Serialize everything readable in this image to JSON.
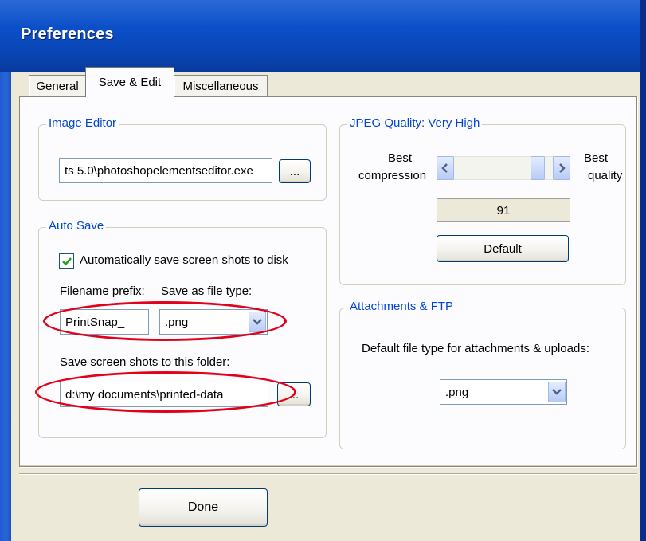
{
  "window": {
    "title": "Preferences"
  },
  "tabs": [
    {
      "label": "General",
      "active": false
    },
    {
      "label": "Save & Edit",
      "active": true
    },
    {
      "label": "Miscellaneous",
      "active": false
    }
  ],
  "image_editor": {
    "legend": "Image Editor",
    "path_value": "ts 5.0\\photoshopelementseditor.exe",
    "browse_label": "..."
  },
  "auto_save": {
    "legend": "Auto Save",
    "checkbox_label": "Automatically save screen shots to disk",
    "checkbox_checked": true,
    "prefix_label": "Filename prefix:",
    "prefix_value": "PrintSnap_",
    "filetype_label": "Save as file type:",
    "filetype_value": ".png",
    "folder_label": "Save screen shots to this folder:",
    "folder_value": "d:\\my documents\\printed-data",
    "folder_browse_label": "..."
  },
  "jpeg_quality": {
    "legend": "JPEG Quality: Very High",
    "left_label_line1": "Best",
    "left_label_line2": "compression",
    "right_label_line1": "Best",
    "right_label_line2": "quality",
    "value": "91",
    "slider_fraction": 0.91,
    "default_label": "Default"
  },
  "attachments": {
    "legend": "Attachments & FTP",
    "label": "Default file type for attachments & uploads:",
    "filetype_value": ".png"
  },
  "footer": {
    "done_label": "Done"
  },
  "colors": {
    "accent_title": "#0B4FC8",
    "legend_text": "#0046D5",
    "highlight_oval": "#E2001A"
  }
}
